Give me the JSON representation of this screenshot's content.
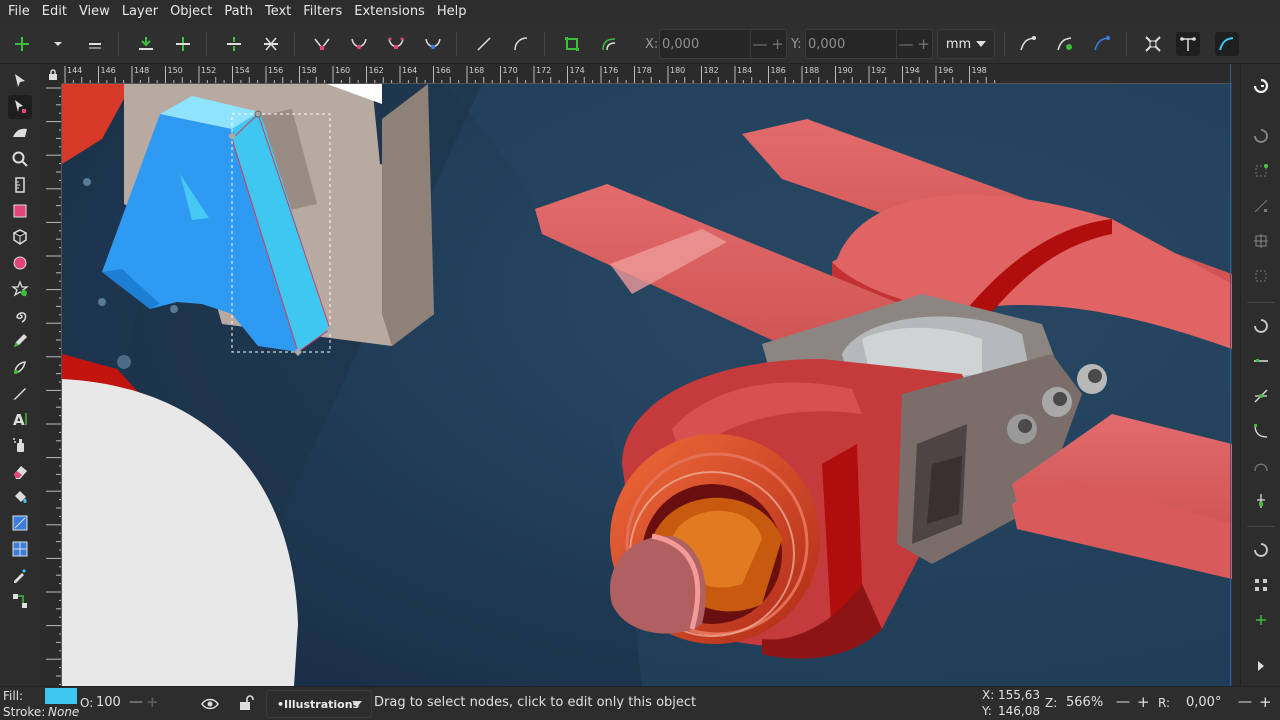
{
  "menu": [
    "File",
    "Edit",
    "View",
    "Layer",
    "Object",
    "Path",
    "Text",
    "Filters",
    "Extensions",
    "Help"
  ],
  "toolbar": {
    "x_label": "X:",
    "x_value": "0,000",
    "y_label": "Y:",
    "y_value": "0,000",
    "unit": "mm",
    "minus": "—",
    "plus": "+"
  },
  "ruler": {
    "h_labels": [
      "144",
      "146",
      "148",
      "150",
      "152",
      "154",
      "156",
      "158",
      "160",
      "162",
      "164",
      "166",
      "168",
      "170",
      "172",
      "174",
      "176",
      "178",
      "180",
      "182",
      "184",
      "186",
      "188",
      "190",
      "192",
      "194",
      "196",
      "198"
    ]
  },
  "status": {
    "fill_label": "Fill:",
    "stroke_label": "Stroke:",
    "stroke_value": "None",
    "opacity_label": "O:",
    "opacity_value": "100",
    "layer": "•Illustrations",
    "message": "Drag to select nodes, click to edit only this object",
    "cursor_x_label": "X:",
    "cursor_x": "155,63",
    "cursor_y_label": "Y:",
    "cursor_y": "146,08",
    "zoom_label": "Z:",
    "zoom": "566%",
    "rotate_label": "R:",
    "rotate": "0,00°",
    "minus": "—",
    "plus": "+"
  },
  "colors": {
    "canvas_bg": "#1f3a52",
    "selected_fill": "#3ec7f0",
    "ship_red": "#d75a5a",
    "node_green": "#3bbf3b"
  }
}
